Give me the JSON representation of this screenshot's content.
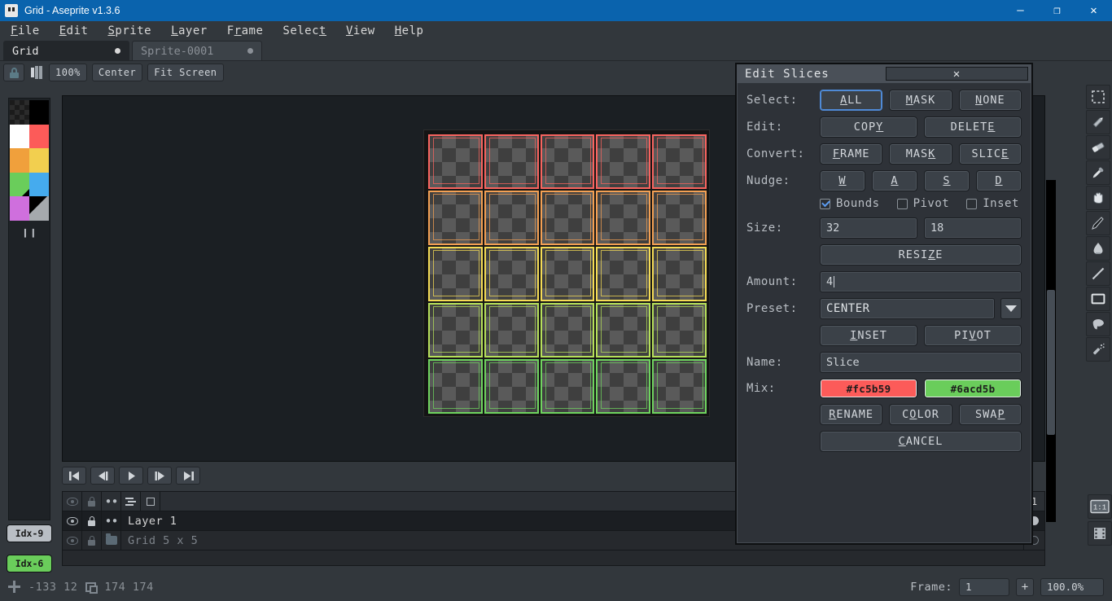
{
  "window": {
    "title": "Grid - Aseprite v1.3.6",
    "app_icon": "aseprite-icon",
    "minimize": "—",
    "maximize": "❐",
    "close": "✕"
  },
  "menubar": {
    "items": [
      {
        "label": "File",
        "accel": "F"
      },
      {
        "label": "Edit",
        "accel": "E"
      },
      {
        "label": "Sprite",
        "accel": "S"
      },
      {
        "label": "Layer",
        "accel": "L"
      },
      {
        "label": "Frame",
        "accel": "r"
      },
      {
        "label": "Select",
        "accel": "t"
      },
      {
        "label": "View",
        "accel": "V"
      },
      {
        "label": "Help",
        "accel": "H"
      }
    ]
  },
  "document_tabs": [
    {
      "label": "Grid",
      "active": true,
      "modified": true
    },
    {
      "label": "Sprite-0001",
      "active": false,
      "modified": true
    }
  ],
  "options_toolbar": {
    "lock_icon": "lock-icon",
    "grid_icon": "grid-settings-icon",
    "buttons": [
      "100%",
      "Center",
      "Fit Screen"
    ]
  },
  "palette": {
    "colors": [
      {
        "name": "transparent",
        "hex": "checker"
      },
      {
        "name": "black",
        "hex": "#000000"
      },
      {
        "name": "white",
        "hex": "#ffffff"
      },
      {
        "name": "red",
        "hex": "#fc5b59"
      },
      {
        "name": "orange",
        "hex": "#f0a03c"
      },
      {
        "name": "yellow",
        "hex": "#f2cf4f"
      },
      {
        "name": "green",
        "hex": "#6acd5b"
      },
      {
        "name": "blue",
        "hex": "#45abee"
      },
      {
        "name": "magenta",
        "hex": "#cf6fdd"
      },
      {
        "name": "gray",
        "hex": "#a5a9ad"
      }
    ],
    "pause_glyph": "❙❙",
    "index_chips": [
      {
        "label": "Idx-9",
        "bg": "#b9bec4"
      },
      {
        "label": "Idx-6",
        "bg": "#6acd5b"
      }
    ]
  },
  "canvas": {
    "slice_grid": {
      "rows": 5,
      "cols": 5,
      "row_colors": [
        "#f9645f",
        "#f4a053",
        "#f5dc55",
        "#b6e05a",
        "#6fd45f"
      ],
      "col_tint": [
        "#ff5a54",
        "#fb6a58",
        "#f97a58",
        "#f6925a",
        "#f4a658"
      ]
    }
  },
  "playback": {
    "buttons": [
      {
        "name": "first-frame",
        "glyph": "first"
      },
      {
        "name": "previous-frame",
        "glyph": "prev"
      },
      {
        "name": "play",
        "glyph": "play"
      },
      {
        "name": "next-frame",
        "glyph": "next"
      },
      {
        "name": "last-frame",
        "glyph": "last"
      }
    ]
  },
  "timeline": {
    "header_frame_number": "1",
    "layers": [
      {
        "name": "Layer 1",
        "selected": true,
        "cel": "filled"
      },
      {
        "name": "Grid 5 x 5",
        "selected": false,
        "cel": "empty"
      }
    ]
  },
  "toolbox": {
    "tools": [
      "rectangular-marquee-icon",
      "pencil-icon",
      "eraser-icon",
      "eyedropper-icon",
      "hand-icon",
      "ink-brush-icon",
      "paint-bucket-icon",
      "line-icon",
      "rectangle-icon",
      "lasso-icon",
      "spray-icon"
    ],
    "bottom": [
      "zoom-1to1-button",
      "film-strip-button"
    ]
  },
  "statusbar": {
    "cursor_icon": "crosshair-icon",
    "position": "-133 12",
    "selection_icon": "selection-size-icon",
    "size": "174 174",
    "frame_label": "Frame:",
    "frame_value": "1",
    "add_frame": "+",
    "zoom_value": "100.0%"
  },
  "dialog": {
    "title": "Edit Slices",
    "close_glyph": "✕",
    "rows": {
      "select": {
        "label": "Select:",
        "buttons": [
          {
            "label": "ALL",
            "accel": "A",
            "focused": true
          },
          {
            "label": "MASK",
            "accel": "M"
          },
          {
            "label": "NONE",
            "accel": "N"
          }
        ]
      },
      "edit": {
        "label": "Edit:",
        "buttons": [
          {
            "label": "COPY",
            "accel": "Y"
          },
          {
            "label": "DELETE",
            "accel": "E"
          }
        ]
      },
      "convert": {
        "label": "Convert:",
        "buttons": [
          {
            "label": "FRAME",
            "accel": "F"
          },
          {
            "label": "MASK",
            "accel": "K"
          },
          {
            "label": "SLICE",
            "accel": "E"
          }
        ]
      },
      "nudge": {
        "label": "Nudge:",
        "buttons": [
          {
            "label": "W",
            "accel": "W"
          },
          {
            "label": "A",
            "accel": "A"
          },
          {
            "label": "S",
            "accel": "S"
          },
          {
            "label": "D",
            "accel": "D"
          }
        ]
      },
      "checkboxes": [
        {
          "label": "Bounds",
          "checked": true
        },
        {
          "label": "Pivot",
          "checked": false
        },
        {
          "label": "Inset",
          "checked": false
        }
      ],
      "size": {
        "label": "Size:",
        "width_value": "32",
        "height_value": "18",
        "resize_button": {
          "label": "RESIZE",
          "accel": "Z"
        }
      },
      "amount": {
        "label": "Amount:",
        "value": "4"
      },
      "preset": {
        "label": "Preset:",
        "value": "CENTER",
        "dropdown_icon": "chevron-down-icon",
        "buttons": [
          {
            "label": "INSET",
            "accel": "I"
          },
          {
            "label": "PIVOT",
            "accel": "V"
          }
        ]
      },
      "name": {
        "label": "Name:",
        "value": "Slice"
      },
      "mix": {
        "label": "Mix:",
        "swatches": [
          {
            "hex": "#fc5b59",
            "label": "#fc5b59"
          },
          {
            "hex": "#6acd5b",
            "label": "#6acd5b"
          }
        ],
        "buttons": [
          {
            "label": "RENAME",
            "accel": "R"
          },
          {
            "label": "COLOR",
            "accel": "O"
          },
          {
            "label": "SWAP",
            "accel": "P"
          }
        ]
      },
      "cancel": {
        "label": "CANCEL",
        "accel": "C"
      }
    }
  }
}
